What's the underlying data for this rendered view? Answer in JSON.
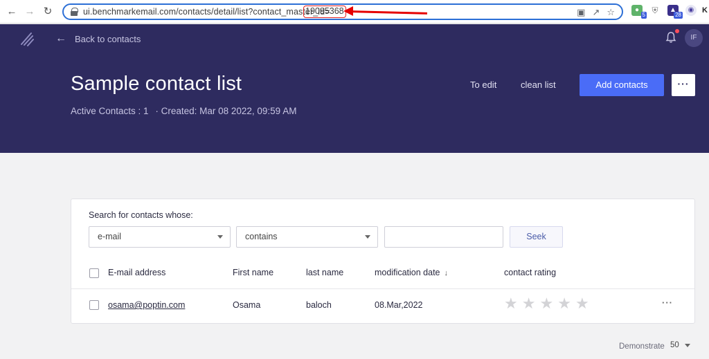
{
  "browser": {
    "url": "ui.benchmarkemail.com/contacts/detail/list?contact_master_id=",
    "url_id": "19095368",
    "ext_badges": [
      "5",
      "28"
    ],
    "avatar_letter": "K"
  },
  "header": {
    "back_label": "Back to contacts",
    "user_initials": "IF",
    "title": "Sample contact list",
    "active_contacts": "Active Contacts : 1",
    "created": "· Created: Mar 08 2022, 09:59 AM",
    "edit_label": "To edit",
    "clean_label": "clean list",
    "add_label": "Add contacts",
    "more_label": "···"
  },
  "search": {
    "label": "Search for contacts whose:",
    "field_value": "e-mail",
    "operator_value": "contains",
    "query_value": "",
    "query_placeholder": "",
    "seek_label": "Seek"
  },
  "table": {
    "columns": [
      "E-mail address",
      "First name",
      "last name",
      "modification date",
      "contact rating"
    ],
    "sort_indicator": "↓",
    "rows": [
      {
        "email": "osama@poptin.com",
        "first_name": "Osama",
        "last_name": "baloch",
        "modified": "08.Mar,2022",
        "rating": 0,
        "more": "···"
      }
    ]
  },
  "footer": {
    "per_page_label": "Demonstrate",
    "per_page_value": "50"
  },
  "colors": {
    "header_bg": "#2e2b5f",
    "primary": "#4a6cf7",
    "annotation": "#e60000"
  }
}
